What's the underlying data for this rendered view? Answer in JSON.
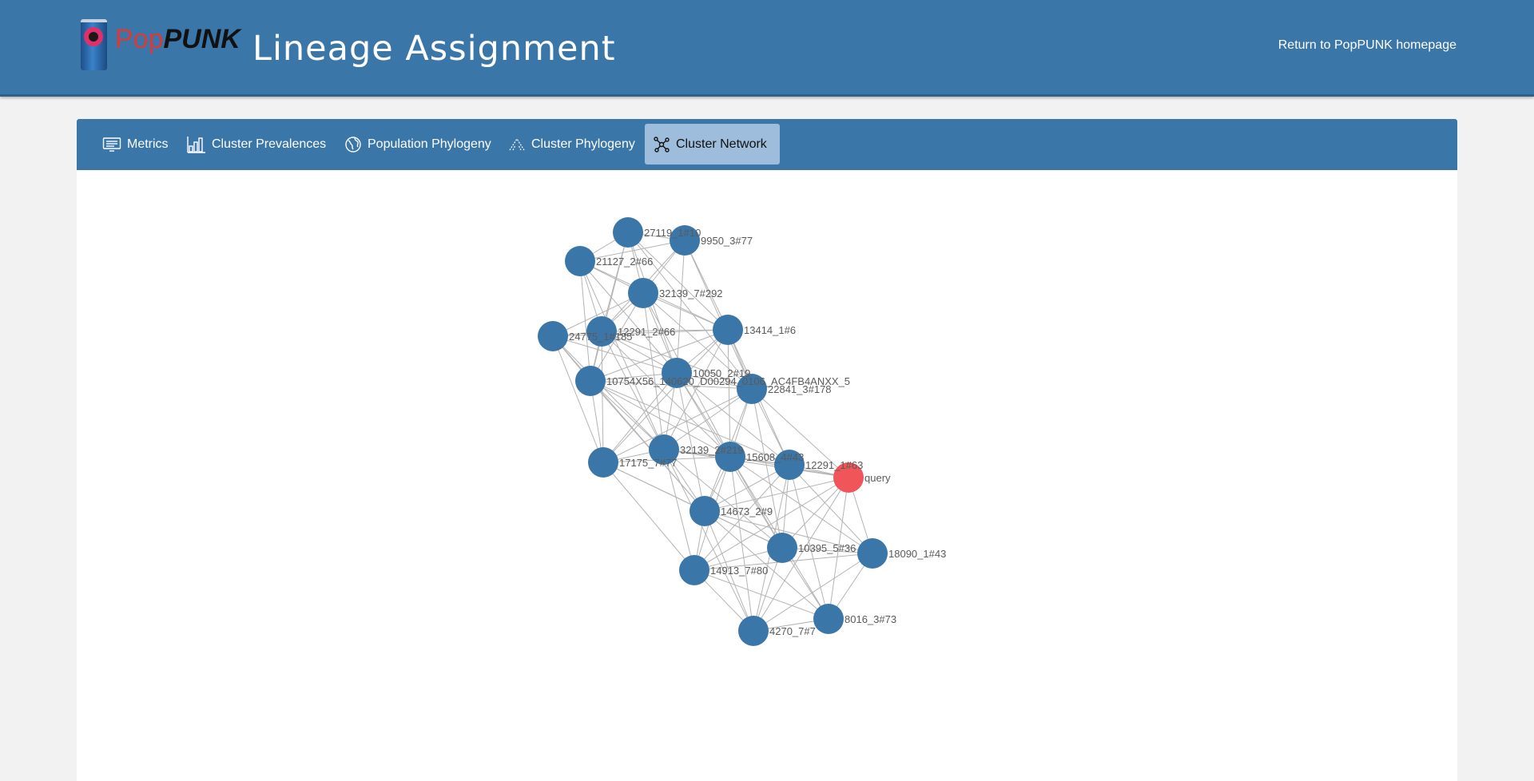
{
  "header": {
    "logo_pop": "Pop",
    "logo_punk": "PUNK",
    "title": "Lineage Assignment",
    "home_link": "Return to PopPUNK homepage"
  },
  "tabs": [
    {
      "label": "Metrics",
      "icon": "monitor-icon",
      "active": false
    },
    {
      "label": "Cluster Prevalences",
      "icon": "bar-chart-icon",
      "active": false
    },
    {
      "label": "Population Phylogeny",
      "icon": "globe-icon",
      "active": false
    },
    {
      "label": "Cluster Phylogeny",
      "icon": "tree-icon",
      "active": false
    },
    {
      "label": "Cluster Network",
      "icon": "network-icon",
      "active": true
    }
  ],
  "network": {
    "colors": {
      "node": "#3b76a9",
      "query": "#f0555a",
      "edge": "#b4b4b4"
    },
    "nodes": [
      {
        "id": "n1",
        "label": "27119_1#10"
      },
      {
        "id": "n2",
        "label": "9950_3#77"
      },
      {
        "id": "n3",
        "label": "21127_2#66"
      },
      {
        "id": "n4",
        "label": "32139_7#292"
      },
      {
        "id": "n5",
        "label": "24775_1#185"
      },
      {
        "id": "n6",
        "label": "12291_2#66"
      },
      {
        "id": "n7",
        "label": "13414_1#6"
      },
      {
        "id": "n8",
        "label": "10754X56_140620_D00294_0106_AC4FB4ANXX_5"
      },
      {
        "id": "n9",
        "label": "10050_2#19"
      },
      {
        "id": "n10",
        "label": "22841_3#178"
      },
      {
        "id": "n11",
        "label": "17175_7#77"
      },
      {
        "id": "n12",
        "label": "32139_2#219"
      },
      {
        "id": "n13",
        "label": "15608_4#43"
      },
      {
        "id": "n14",
        "label": "12291_1#63"
      },
      {
        "id": "q",
        "label": "query",
        "query": true
      },
      {
        "id": "n15",
        "label": "14673_2#9"
      },
      {
        "id": "n16",
        "label": "10395_5#36"
      },
      {
        "id": "n17",
        "label": "18090_1#43"
      },
      {
        "id": "n18",
        "label": "14913_7#80"
      },
      {
        "id": "n19",
        "label": "8016_3#73"
      },
      {
        "id": "n20",
        "label": "4270_7#7"
      }
    ]
  }
}
